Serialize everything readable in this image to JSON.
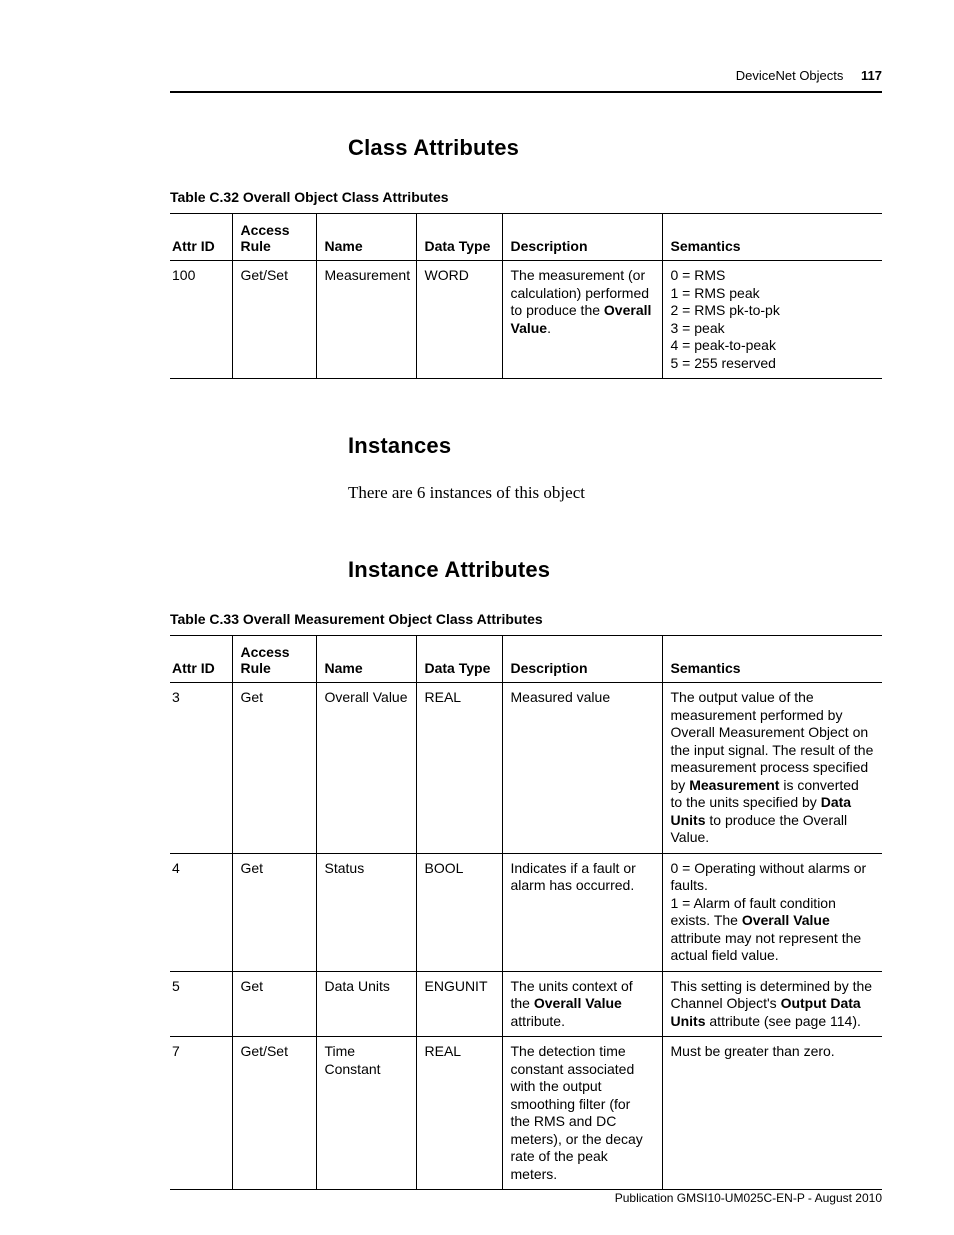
{
  "header": {
    "section": "DeviceNet Objects",
    "page_number": "117"
  },
  "section1": {
    "heading": "Class Attributes",
    "caption": "Table C.32 Overall Object Class Attributes"
  },
  "columns": {
    "attr_id": "Attr ID",
    "access_rule_line1": "Access",
    "access_rule_line2": "Rule",
    "name": "Name",
    "data_type": "Data Type",
    "description": "Description",
    "semantics": "Semantics"
  },
  "t1": {
    "r0": {
      "id": "100",
      "rule": "Get/Set",
      "name": "Measurement",
      "dtype": "WORD",
      "desc_pre": "The measurement (or calculation) performed to produce the ",
      "desc_bold": "Overall Value",
      "desc_post": ".",
      "sem_l0": "0 = RMS",
      "sem_l1": "1 = RMS peak",
      "sem_l2": "2 = RMS pk-to-pk",
      "sem_l3": "3 = peak",
      "sem_l4": "4 = peak-to-peak",
      "sem_l5": "5 = 255 reserved"
    }
  },
  "section2": {
    "heading": "Instances",
    "body": "There are 6 instances of this object"
  },
  "section3": {
    "heading": "Instance Attributes",
    "caption": "Table C.33 Overall Measurement Object Class Attributes"
  },
  "t2": {
    "r0": {
      "id": "3",
      "rule": "Get",
      "name": "Overall Value",
      "dtype": "REAL",
      "desc": "Measured value",
      "sem_pre": "The output value of the measurement performed by Overall Measurement Object on the input signal. The result of the measurement process specified by ",
      "sem_b1": "Measurement",
      "sem_mid": " is converted to the units specified by ",
      "sem_b2": "Data Units",
      "sem_post": " to produce the Overall Value."
    },
    "r1": {
      "id": "4",
      "rule": "Get",
      "name": "Status",
      "dtype": "BOOL",
      "desc": "Indicates if a fault or alarm has occurred.",
      "sem_l0": "0 = Operating without alarms or faults.",
      "sem_l1_pre": "1 = Alarm of fault condition exists. The ",
      "sem_l1_b": "Overall Value",
      "sem_l1_post": " attribute may not represent the actual field value."
    },
    "r2": {
      "id": "5",
      "rule": "Get",
      "name": "Data Units",
      "dtype": "ENGUNIT",
      "desc_pre": "The units context of the ",
      "desc_b": "Overall Value",
      "desc_post": " attribute.",
      "sem_pre": "This setting is determined by the Channel Object's ",
      "sem_b": "Output Data Units",
      "sem_post": " attribute (see page 114)."
    },
    "r3": {
      "id": "7",
      "rule": "Get/Set",
      "name": "Time Constant",
      "dtype": "REAL",
      "desc": "The detection time constant associated with the output smoothing filter (for the RMS and DC meters), or the decay rate of the peak meters.",
      "sem": "Must be greater than zero."
    }
  },
  "footer": {
    "text": "Publication GMSI10-UM025C-EN-P - August 2010"
  }
}
